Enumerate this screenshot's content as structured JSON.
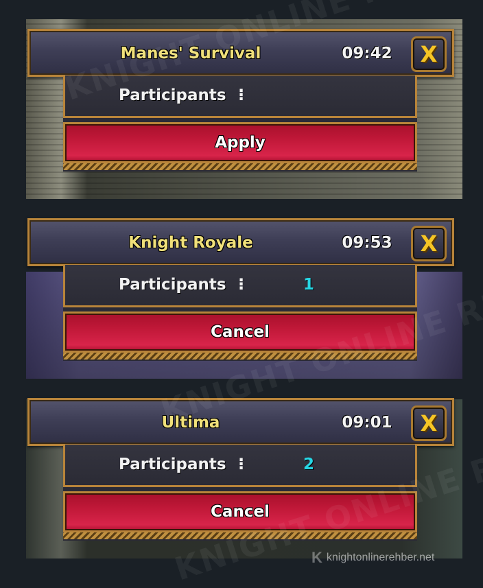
{
  "panels": [
    {
      "title": "Manes' Survival",
      "time": "09:42",
      "close_label": "X",
      "participants_label": "Participants",
      "separator": "⁝",
      "participants_count": "",
      "action_label": "Apply"
    },
    {
      "title": "Knight Royale",
      "time": "09:53",
      "close_label": "X",
      "participants_label": "Participants",
      "separator": "⁝",
      "participants_count": "1",
      "action_label": "Cancel"
    },
    {
      "title": "Ultima",
      "time": "09:01",
      "close_label": "X",
      "participants_label": "Participants",
      "separator": "⁝",
      "participants_count": "2",
      "action_label": "Cancel"
    }
  ],
  "watermark": {
    "brand": "KNIGHT ONLINE REHBER",
    "site": "knightonlinerehber.net",
    "logo_letter": "K"
  },
  "colors": {
    "title_text": "#f0e07a",
    "count_text": "#26d6e4",
    "frame_gold": "#b8843a",
    "action_red": "#c01838",
    "close_x": "#f5c525"
  }
}
